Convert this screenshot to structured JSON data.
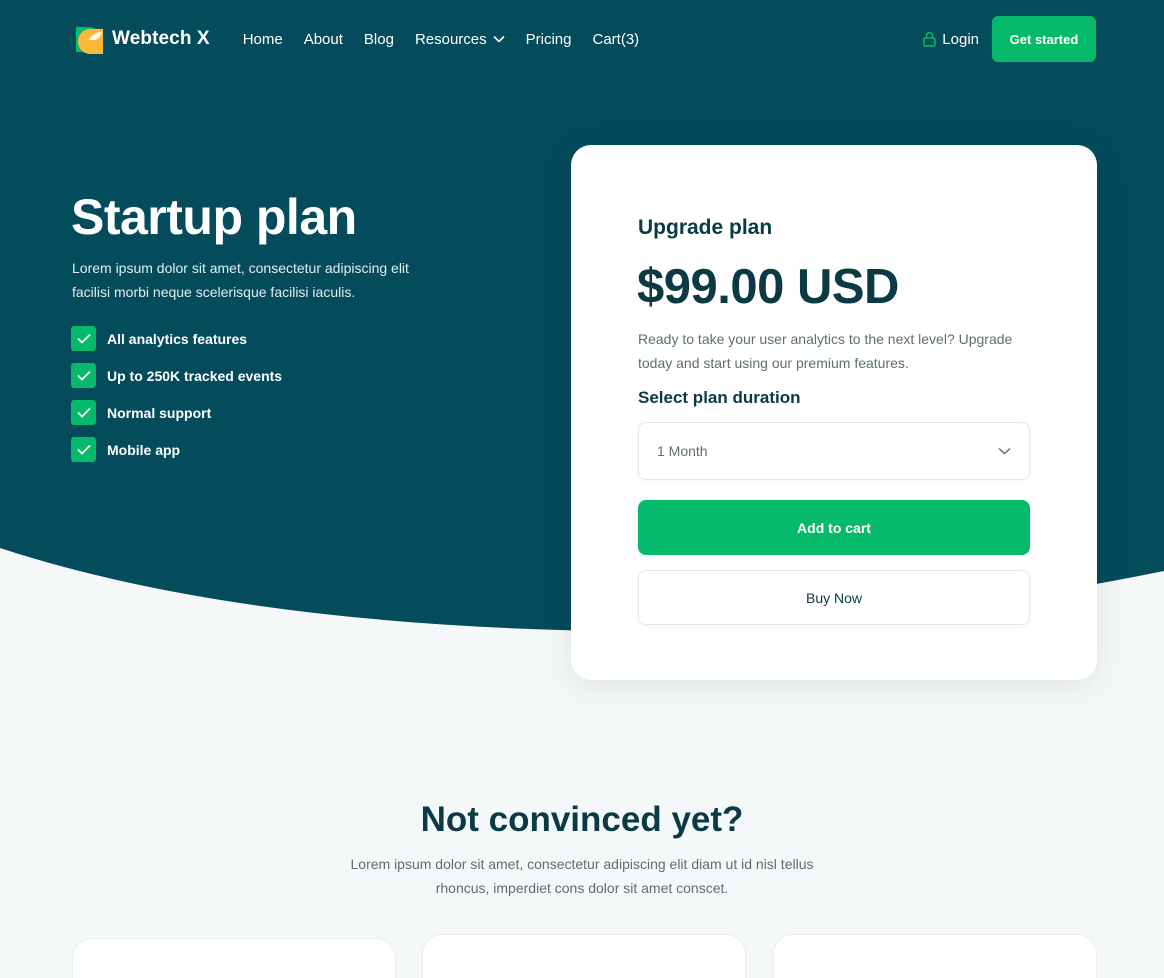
{
  "brand": {
    "name": "Webtech X"
  },
  "nav": {
    "links": [
      "Home",
      "About",
      "Blog",
      "Resources",
      "Pricing",
      "Cart(3)"
    ],
    "login": "Login",
    "cta": "Get started"
  },
  "hero": {
    "title": "Startup plan",
    "description": "Lorem ipsum dolor sit amet, consectetur adipiscing elit facilisi morbi neque scelerisque facilisi iaculis.",
    "features": [
      "All analytics features",
      "Up to 250K tracked events",
      "Normal support",
      "Mobile app"
    ]
  },
  "card": {
    "title": "Upgrade plan",
    "price": "$99.00 USD",
    "description": "Ready to take your user analytics to the next level? Upgrade today and start using our premium features.",
    "duration_label": "Select plan duration",
    "duration_value": "1 Month",
    "add_to_cart": "Add to cart",
    "buy_now": "Buy Now"
  },
  "section": {
    "title": "Not convinced yet?",
    "description": "Lorem ipsum dolor sit amet, consectetur adipiscing elit diam ut id nisl tellus rhoncus, imperdiet cons dolor sit amet conscet."
  },
  "colors": {
    "primary": "#044b5b",
    "accent": "#07b96a",
    "dark_text": "#0b3a44",
    "page_bg": "#f5f8f9"
  }
}
